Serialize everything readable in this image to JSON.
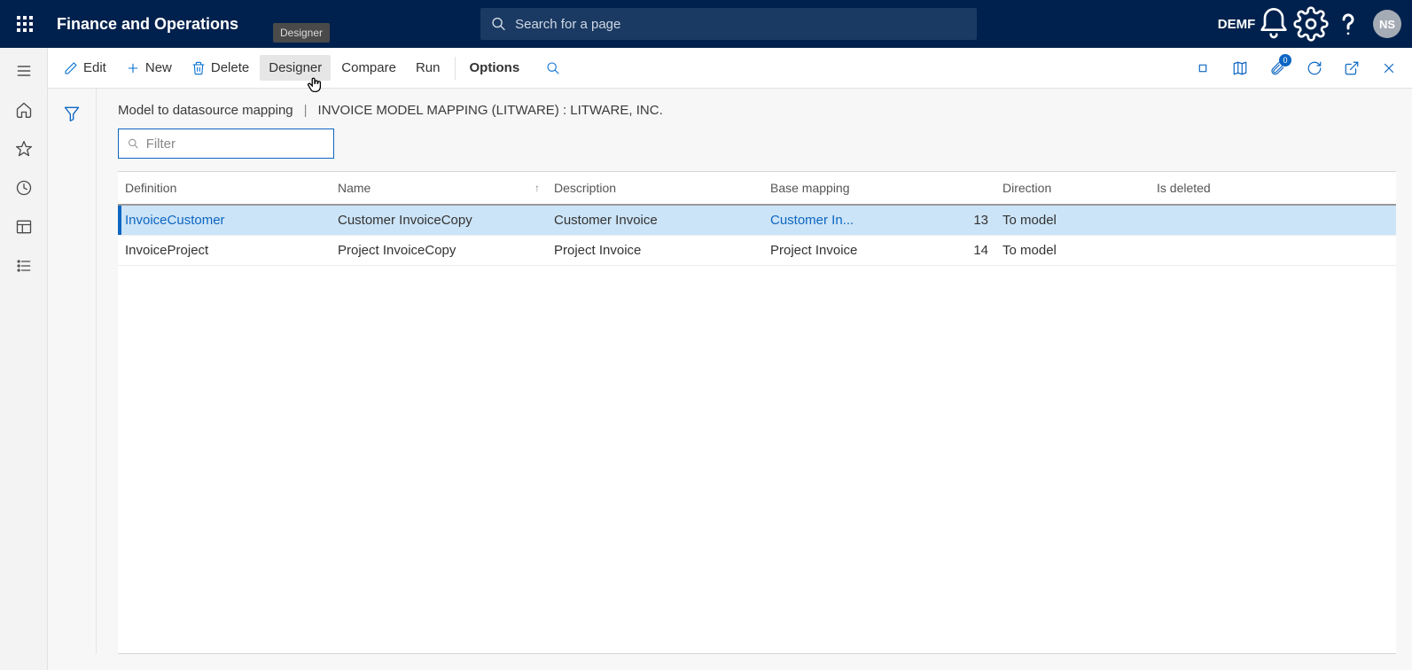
{
  "header": {
    "app_title": "Finance and Operations",
    "search_placeholder": "Search for a page",
    "company": "DEMF",
    "avatar_initials": "NS",
    "tooltip": "Designer"
  },
  "action_bar": {
    "edit": "Edit",
    "new": "New",
    "delete": "Delete",
    "designer": "Designer",
    "compare": "Compare",
    "run": "Run",
    "options": "Options",
    "attach_badge": "0"
  },
  "breadcrumb": {
    "left": "Model to datasource mapping",
    "right": "INVOICE MODEL MAPPING (LITWARE) : LITWARE, INC."
  },
  "filter": {
    "placeholder": "Filter"
  },
  "columns": {
    "definition": "Definition",
    "name": "Name",
    "description": "Description",
    "base_mapping": "Base mapping",
    "direction": "Direction",
    "is_deleted": "Is deleted"
  },
  "rows": [
    {
      "definition": "InvoiceCustomer",
      "name": "Customer InvoiceCopy",
      "description": "Customer Invoice",
      "base_mapping": "Customer In...",
      "seq": "13",
      "direction": "To model",
      "is_deleted": "",
      "selected": true
    },
    {
      "definition": "InvoiceProject",
      "name": "Project InvoiceCopy",
      "description": "Project Invoice",
      "base_mapping": "Project Invoice",
      "seq": "14",
      "direction": "To model",
      "is_deleted": "",
      "selected": false
    }
  ]
}
